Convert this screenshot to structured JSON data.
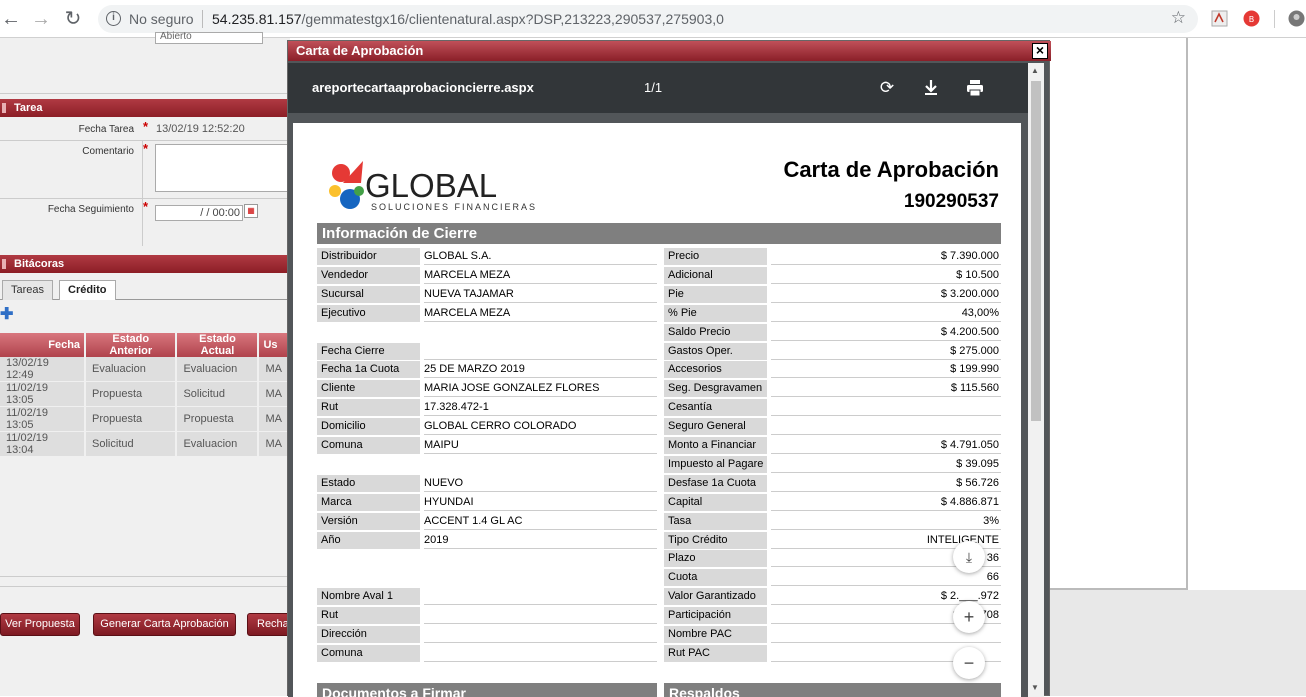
{
  "browser": {
    "back_icon": "back-arrow-icon",
    "security_label": "No seguro",
    "url_host": "54.235.81.157",
    "url_path": "/gemmatestgx16/clientenatural.aspx?DSP,213223,290537,275903,0"
  },
  "left_panel": {
    "top_field_value": "Abierto",
    "tarea": {
      "header": "Tarea",
      "fecha_tarea_label": "Fecha Tarea",
      "fecha_tarea_value": "13/02/19 12:52:20",
      "comentario_label": "Comentario",
      "fecha_seguimiento_label": "Fecha Seguimiento",
      "fecha_seguimiento_value": "/ /  00:00"
    },
    "bitacoras": {
      "header": "Bitácoras",
      "tabs": [
        "Tareas",
        "Crédito"
      ],
      "columns": [
        "Fecha",
        "Estado Anterior",
        "Estado Actual",
        "Us"
      ],
      "rows": [
        [
          "13/02/19 12:49",
          "Evaluacion",
          "Evaluacion",
          "MA"
        ],
        [
          "11/02/19 13:05",
          "Propuesta",
          "Solicitud",
          "MA"
        ],
        [
          "11/02/19 13:05",
          "Propuesta",
          "Propuesta",
          "MA"
        ],
        [
          "11/02/19 13:04",
          "Solicitud",
          "Evaluacion",
          "MA"
        ]
      ]
    },
    "buttons": {
      "ver_propuesta": "Ver Propuesta",
      "generar_carta": "Generar Carta Aprobación",
      "rechazar": "Recha"
    }
  },
  "dialog": {
    "title": "Carta de Aprobación",
    "close": "✕",
    "pdf": {
      "filename": "areportecartaaprobacioncierre.aspx",
      "page": "1/1",
      "document": {
        "logo_text": "GLOBAL",
        "logo_subtext": "SOLUCIONES FINANCIERAS",
        "title": "Carta de Aprobación",
        "number": "190290537",
        "section_header": "Información de Cierre",
        "left_rows": [
          [
            "Distribuidor",
            "GLOBAL S.A."
          ],
          [
            "Vendedor",
            "MARCELA MEZA"
          ],
          [
            "Sucursal",
            "NUEVA TAJAMAR"
          ],
          [
            "Ejecutivo",
            "MARCELA MEZA"
          ],
          [
            "",
            ""
          ],
          [
            "Fecha Cierre",
            ""
          ],
          [
            "Fecha 1a Cuota",
            "25 DE MARZO 2019"
          ],
          [
            "Cliente",
            "MARIA JOSE GONZALEZ FLORES"
          ],
          [
            "Rut",
            "17.328.472-1"
          ],
          [
            "Domicilio",
            "GLOBAL CERRO COLORADO"
          ],
          [
            "Comuna",
            "MAIPU"
          ],
          [
            "",
            ""
          ],
          [
            "Estado",
            "NUEVO"
          ],
          [
            "Marca",
            "HYUNDAI"
          ],
          [
            "Versión",
            "ACCENT 1.4 GL AC"
          ],
          [
            "Año",
            "2019"
          ],
          [
            "",
            ""
          ],
          [
            "",
            ""
          ],
          [
            "Nombre Aval 1",
            ""
          ],
          [
            "Rut",
            ""
          ],
          [
            "Dirección",
            ""
          ],
          [
            "Comuna",
            ""
          ]
        ],
        "right_rows": [
          [
            "Precio",
            "$ 7.390.000"
          ],
          [
            "Adicional",
            "$ 10.500"
          ],
          [
            "Pie",
            "$ 3.200.000"
          ],
          [
            "% Pie",
            "43,00%"
          ],
          [
            "Saldo Precio",
            "$ 4.200.500"
          ],
          [
            "Gastos Oper.",
            "$ 275.000"
          ],
          [
            "Accesorios",
            "$ 199.990"
          ],
          [
            "Seg. Desgravamen",
            "$ 115.560"
          ],
          [
            "Cesantía",
            ""
          ],
          [
            "Seguro General",
            ""
          ],
          [
            "Monto a Financiar",
            "$ 4.791.050"
          ],
          [
            "Impuesto al Pagare",
            "$ 39.095"
          ],
          [
            "Desfase 1a Cuota",
            "$ 56.726"
          ],
          [
            "Capital",
            "$ 4.886.871"
          ],
          [
            "Tasa",
            "3%"
          ],
          [
            "Tipo Crédito",
            "INTELIGENTE"
          ],
          [
            "Plazo",
            "36"
          ],
          [
            "Cuota",
            "66"
          ],
          [
            "Valor Garantizado",
            "$ 2.___.972"
          ],
          [
            "Participación",
            "$ ___708"
          ],
          [
            "Nombre PAC",
            ""
          ],
          [
            "Rut PAC",
            ""
          ]
        ],
        "bottom_left_header": "Documentos a Firmar",
        "bottom_right_header": "Respaldos"
      }
    }
  },
  "colors": {
    "accent": "#9c2a33",
    "pdf_toolbar": "#323639",
    "pdf_bg": "#525659"
  }
}
